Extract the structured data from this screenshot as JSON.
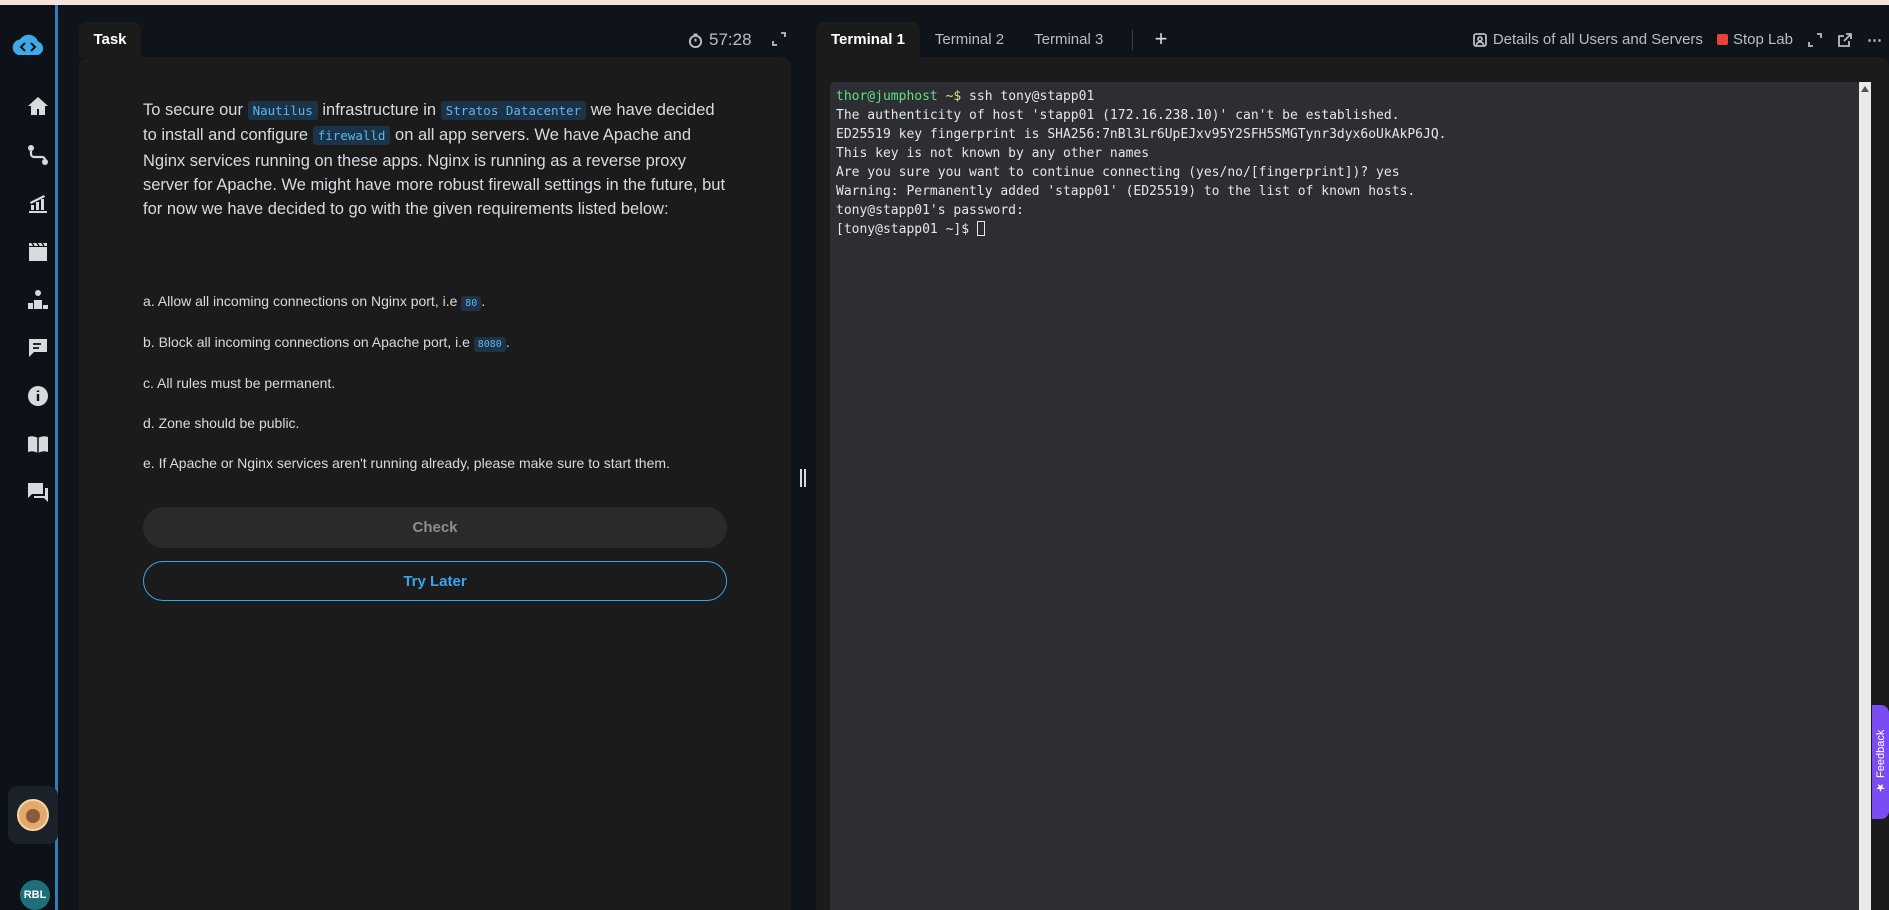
{
  "sidebar": {
    "items": [
      {
        "name": "home-icon"
      },
      {
        "name": "learning-path-icon"
      },
      {
        "name": "progress-icon"
      },
      {
        "name": "playground-icon"
      },
      {
        "name": "leaderboard-icon"
      },
      {
        "name": "feedback-board-icon"
      },
      {
        "name": "info-icon"
      },
      {
        "name": "docs-icon"
      },
      {
        "name": "community-icon"
      }
    ],
    "badge": "RBL"
  },
  "task": {
    "tab_label": "Task",
    "timer": "57:28",
    "intro": {
      "p1": "To secure our ",
      "code1": "Nautilus",
      "p2": " infrastructure in ",
      "code2": "Stratos Datacenter",
      "p3": " we have decided to install and configure ",
      "code3": "firewalld",
      "p4": " on all app servers. We have Apache and Nginx services running on these apps. Nginx is running as a reverse proxy server for Apache. We might have more robust firewall settings in the future, but for now we have decided to go with the given requirements listed below:"
    },
    "requirements": {
      "a_text": "a. Allow all incoming connections on Nginx port, i.e ",
      "a_code": "80",
      "b_text": "b. Block all incoming connections on Apache port, i.e ",
      "b_code": "8080",
      "c": "c. All rules must be permanent.",
      "d": "d. Zone should be public.",
      "e": "e. If Apache or Nginx services aren't running already, please make sure to start them."
    },
    "check_label": "Check",
    "try_later_label": "Try Later"
  },
  "terminal": {
    "tabs": [
      "Terminal 1",
      "Terminal 2",
      "Terminal 3"
    ],
    "add_tab": "+",
    "toolbar": {
      "details_label": "Details of all Users and Servers",
      "stop_label": "Stop Lab",
      "more": "⋯"
    },
    "prompt_user": "thor@jumphost",
    "prompt_tilde": " ~$",
    "command": " ssh tony@stapp01",
    "lines": [
      "The authenticity of host 'stapp01 (172.16.238.10)' can't be established.",
      "ED25519 key fingerprint is SHA256:7nBl3Lr6UpEJxv95Y2SFH5SMGTynr3dyx6oUkAkP6JQ.",
      "This key is not known by any other names",
      "Are you sure you want to continue connecting (yes/no/[fingerprint])? yes",
      "Warning: Permanently added 'stapp01' (ED25519) to the list of known hosts.",
      "tony@stapp01's password: "
    ],
    "final_prompt": "[tony@stapp01 ~]$ "
  },
  "feedback_label": "★ Feedback"
}
